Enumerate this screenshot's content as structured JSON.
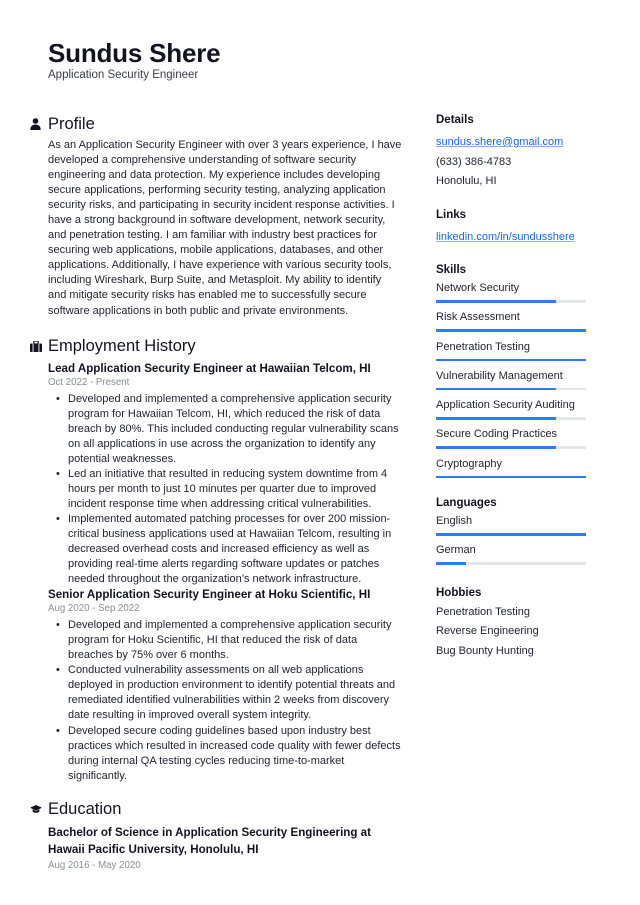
{
  "header": {
    "name": "Sundus Shere",
    "title": "Application Security Engineer"
  },
  "profile": {
    "heading": "Profile",
    "icon": "person-icon",
    "text": "As an Application Security Engineer with over 3 years experience, I have developed a comprehensive understanding of software security engineering and data protection. My experience includes developing secure applications, performing security testing, analyzing application security risks, and participating in security incident response activities. I have a strong background in software development, network security, and penetration testing. I am familiar with industry best practices for securing web applications, mobile applications, databases, and other applications. Additionally, I have experience with various security tools, including Wireshark, Burp Suite, and Metasploit. My ability to identify and mitigate security risks has enabled me to successfully secure software applications in both public and private environments."
  },
  "employment": {
    "heading": "Employment History",
    "icon": "briefcase-icon",
    "jobs": [
      {
        "title": "Lead Application Security Engineer at Hawaiian Telcom, HI",
        "dates": "Oct 2022 - Present",
        "bullets": [
          "Developed and implemented a comprehensive application security program for Hawaiian Telcom, HI, which reduced the risk of data breach by 80%. This included conducting regular vulnerability scans on all applications in use across the organization to identify any potential weaknesses.",
          "Led an initiative that resulted in reducing system downtime from 4 hours per month to just 10 minutes per quarter due to improved incident response time when addressing critical vulnerabilities.",
          "Implemented automated patching processes for over 200 mission-critical business applications used at Hawaiian Telcom, resulting in decreased overhead costs and increased efficiency as well as providing real-time alerts regarding software updates or patches needed throughout the organization’s network infrastructure."
        ]
      },
      {
        "title": "Senior Application Security Engineer at Hoku Scientific, HI",
        "dates": "Aug 2020 - Sep 2022",
        "bullets": [
          "Developed and implemented a comprehensive application security program for Hoku Scientific, HI that reduced the risk of data breaches by 75% over 6 months.",
          "Conducted vulnerability assessments on all web applications deployed in production environment to identify potential threats and remediated identified vulnerabilities within 2 weeks from discovery date resulting in improved overall system integrity.",
          "Developed secure coding guidelines based upon industry best practices which resulted in increased code quality with fewer defects during internal QA testing cycles reducing time-to-market significantly."
        ]
      }
    ]
  },
  "education": {
    "heading": "Education",
    "icon": "graduation-cap-icon",
    "entries": [
      {
        "title": "Bachelor of Science in Application Security Engineering at Hawaii Pacific University, Honolulu, HI",
        "dates": "Aug 2016 - May 2020"
      }
    ]
  },
  "details": {
    "heading": "Details",
    "email": "sundus.shere@gmail.com",
    "phone": "(633) 386-4783",
    "location": "Honolulu, HI"
  },
  "links": {
    "heading": "Links",
    "items": [
      "linkedin.com/in/sundusshere"
    ]
  },
  "skills": {
    "heading": "Skills",
    "items": [
      {
        "label": "Network Security",
        "level": 0.8
      },
      {
        "label": "Risk Assessment",
        "level": 1.0
      },
      {
        "label": "Penetration Testing",
        "level": 1.0
      },
      {
        "label": "Vulnerability Management",
        "level": 0.8
      },
      {
        "label": "Application Security Auditing",
        "level": 0.8
      },
      {
        "label": "Secure Coding Practices",
        "level": 0.8
      },
      {
        "label": "Cryptography",
        "level": 1.0
      }
    ]
  },
  "languages": {
    "heading": "Languages",
    "items": [
      {
        "label": "English",
        "level": 1.0
      },
      {
        "label": "German",
        "level": 0.2
      }
    ]
  },
  "hobbies": {
    "heading": "Hobbies",
    "items": [
      "Penetration Testing",
      "Reverse Engineering",
      "Bug Bounty Hunting"
    ]
  },
  "colors": {
    "accent": "#2f7cf0",
    "link": "#1a66e8",
    "track": "#e4e6ea",
    "muted": "#8b8e98"
  }
}
